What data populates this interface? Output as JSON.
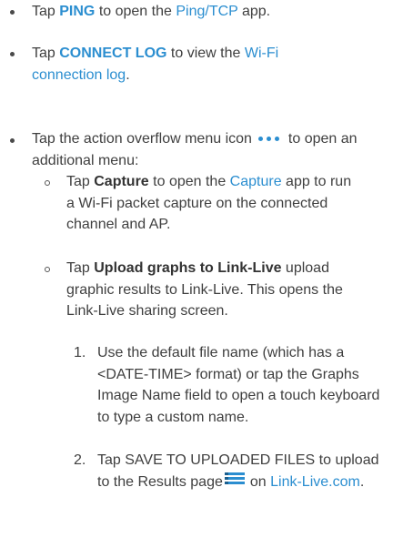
{
  "items": {
    "ping": {
      "pre": "Tap ",
      "kw": "PING",
      "mid": " to open the ",
      "link": "Ping/TCP",
      "post": " app."
    },
    "connect_log": {
      "pre": "Tap ",
      "kw": "CONNECT LOG",
      "mid": " to view the ",
      "link": "Wi-Fi connection log",
      "post": "."
    },
    "overflow": {
      "pre": "Tap the action overflow menu icon",
      "post": "to open an additional menu:",
      "icon": "more-horizontal-icon"
    },
    "capture": {
      "pre": "Tap ",
      "b": "Capture",
      "mid": " to open the ",
      "link": "Capture",
      "post": " app to run a Wi-Fi packet capture on the connected channel and AP."
    },
    "upload": {
      "pre": "Tap ",
      "b": "Upload graphs to Link-Live",
      "post": " upload graphic results to Link-Live. This opens the Link-Live sharing screen."
    },
    "step1": {
      "num": "1.",
      "text": "Use the default file name (which has a <DATE-TIME> format) or tap the Graphs Image Name field to open a touch keyboard to type a custom name."
    },
    "step2": {
      "num": "2.",
      "pre": "Tap SAVE TO UPLOADED FILES to upload to the Results page",
      "post": "on",
      "link": "Link-Live.com",
      "end": ".",
      "icon": "results-list-icon"
    }
  },
  "colors": {
    "accent": "#2b8ed0",
    "text": "#3f3f3f"
  }
}
